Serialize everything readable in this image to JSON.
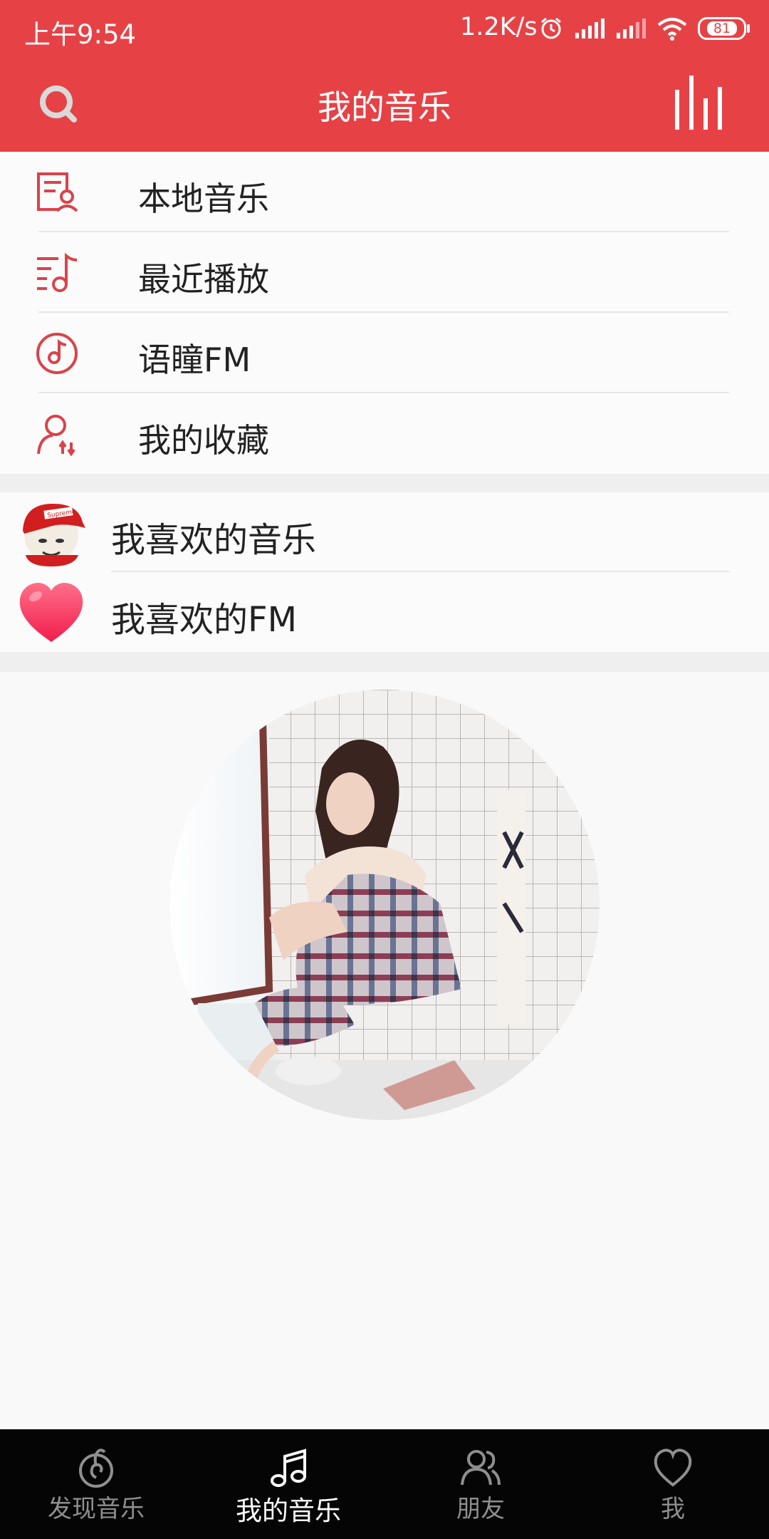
{
  "status": {
    "time": "上午9:54",
    "speed": "1.2K/s",
    "battery": "81"
  },
  "header": {
    "title": "我的音乐"
  },
  "menu": [
    {
      "label": "本地音乐",
      "icon": "local-music-icon"
    },
    {
      "label": "最近播放",
      "icon": "recent-play-icon"
    },
    {
      "label": "语瞳FM",
      "icon": "fm-icon"
    },
    {
      "label": "我的收藏",
      "icon": "collection-icon"
    }
  ],
  "favorites": [
    {
      "label": "我喜欢的音乐",
      "icon": "cartoon-avatar-icon"
    },
    {
      "label": "我喜欢的FM",
      "icon": "heart-icon"
    }
  ],
  "nav": [
    {
      "label": "发现音乐"
    },
    {
      "label": "我的音乐"
    },
    {
      "label": "朋友"
    },
    {
      "label": "我"
    }
  ],
  "colors": {
    "accent": "#e64246",
    "nav_bg": "#050505"
  }
}
